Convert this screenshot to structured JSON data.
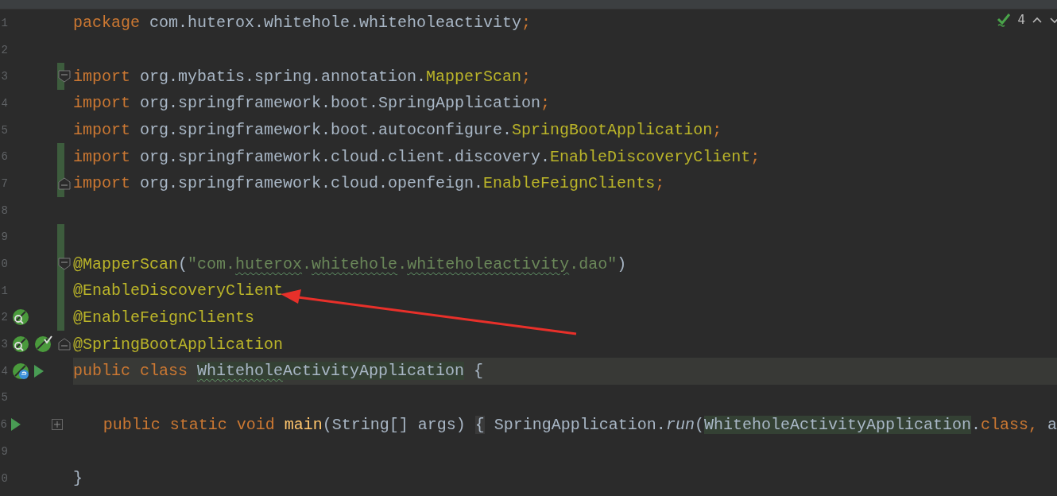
{
  "inspection_widget": {
    "count": "4"
  },
  "lines": [
    {
      "number": "1",
      "changed": false,
      "tokens": [
        {
          "kind": "keyword",
          "text": "package "
        },
        {
          "kind": "plain",
          "text": "com.huterox.whitehole.whiteholeactivity"
        },
        {
          "kind": "keyword",
          "text": ";"
        }
      ]
    },
    {
      "number": "2",
      "changed": false
    },
    {
      "number": "3",
      "changed": true,
      "fold": {
        "kind": "start"
      },
      "tokens": [
        {
          "kind": "keyword",
          "text": "import "
        },
        {
          "kind": "plain",
          "text": "org.mybatis.spring.annotation."
        },
        {
          "kind": "annotation",
          "text": "MapperScan"
        },
        {
          "kind": "keyword",
          "text": ";"
        }
      ]
    },
    {
      "number": "4",
      "changed": false,
      "tokens": [
        {
          "kind": "keyword",
          "text": "import "
        },
        {
          "kind": "plain",
          "text": "org.springframework.boot.SpringApplication"
        },
        {
          "kind": "keyword",
          "text": ";"
        }
      ]
    },
    {
      "number": "5",
      "changed": false,
      "tokens": [
        {
          "kind": "keyword",
          "text": "import "
        },
        {
          "kind": "plain",
          "text": "org.springframework.boot.autoconfigure."
        },
        {
          "kind": "annotation",
          "text": "SpringBootApplication"
        },
        {
          "kind": "keyword",
          "text": ";"
        }
      ]
    },
    {
      "number": "6",
      "changed": true,
      "tokens": [
        {
          "kind": "keyword",
          "text": "import "
        },
        {
          "kind": "plain",
          "text": "org.springframework.cloud.client.discovery."
        },
        {
          "kind": "annotation",
          "text": "EnableDiscoveryClient"
        },
        {
          "kind": "keyword",
          "text": ";"
        }
      ]
    },
    {
      "number": "7",
      "changed": true,
      "fold": {
        "kind": "end"
      },
      "tokens": [
        {
          "kind": "keyword",
          "text": "import "
        },
        {
          "kind": "plain",
          "text": "org.springframework.cloud.openfeign."
        },
        {
          "kind": "annotation",
          "text": "EnableFeignClients"
        },
        {
          "kind": "keyword",
          "text": ";"
        }
      ]
    },
    {
      "number": "8",
      "changed": false
    },
    {
      "number": "9",
      "changed": true
    },
    {
      "number": "0",
      "changed": true,
      "fold": {
        "kind": "start"
      },
      "tokens": [
        {
          "kind": "annotation",
          "text": "@MapperScan"
        },
        {
          "kind": "plain",
          "text": "("
        },
        {
          "kind": "string",
          "text": "\"com."
        },
        {
          "kind": "string-typo",
          "text": "huterox"
        },
        {
          "kind": "string",
          "text": "."
        },
        {
          "kind": "string-typo",
          "text": "whitehole"
        },
        {
          "kind": "string",
          "text": "."
        },
        {
          "kind": "string-typo",
          "text": "whiteholeactivity"
        },
        {
          "kind": "string",
          "text": ".dao\""
        },
        {
          "kind": "plain",
          "text": ")"
        }
      ]
    },
    {
      "number": "1",
      "changed": true,
      "tokens": [
        {
          "kind": "annotation",
          "text": "@EnableDiscoveryClient"
        }
      ]
    },
    {
      "number": "2",
      "changed": true,
      "markers": [
        {
          "kind": "bean-search"
        }
      ],
      "tokens": [
        {
          "kind": "annotation",
          "text": "@EnableFeignClients"
        }
      ]
    },
    {
      "number": "3",
      "changed": false,
      "fold": {
        "kind": "end"
      },
      "markers": [
        {
          "kind": "bean-search"
        },
        {
          "kind": "bean-check"
        }
      ],
      "tokens": [
        {
          "kind": "annotation",
          "text": "@SpringBootApplication"
        }
      ]
    },
    {
      "number": "4",
      "changed": false,
      "current": true,
      "markers": [
        {
          "kind": "bean-web"
        },
        {
          "kind": "run"
        }
      ],
      "tokens": [
        {
          "kind": "keyword",
          "text": "public class "
        },
        {
          "kind": "usage-typo",
          "text": "Whitehole"
        },
        {
          "kind": "usage",
          "text": "ActivityApplication"
        },
        {
          "kind": "plain",
          "text": " {"
        }
      ]
    },
    {
      "number": "5",
      "changed": false
    },
    {
      "number": "6",
      "changed": false,
      "fold": {
        "kind": "collapsed"
      },
      "markers": [
        {
          "kind": "run"
        }
      ],
      "tokens": [
        {
          "kind": "keyword",
          "text": "    public static void "
        },
        {
          "kind": "method",
          "text": "main"
        },
        {
          "kind": "plain",
          "text": "(String[] args) "
        },
        {
          "kind": "folded",
          "text": "{"
        },
        {
          "kind": "plain",
          "text": " SpringApplication."
        },
        {
          "kind": "static-call",
          "text": "run"
        },
        {
          "kind": "plain",
          "text": "("
        },
        {
          "kind": "usage",
          "text": "WhiteholeActivityApplication"
        },
        {
          "kind": "plain",
          "text": "."
        },
        {
          "kind": "keyword",
          "text": "class, "
        },
        {
          "kind": "plain",
          "text": "a"
        }
      ]
    },
    {
      "number": "9",
      "changed": false
    },
    {
      "number": "0",
      "changed": false,
      "tokens": [
        {
          "kind": "plain",
          "text": "}"
        }
      ]
    }
  ]
}
